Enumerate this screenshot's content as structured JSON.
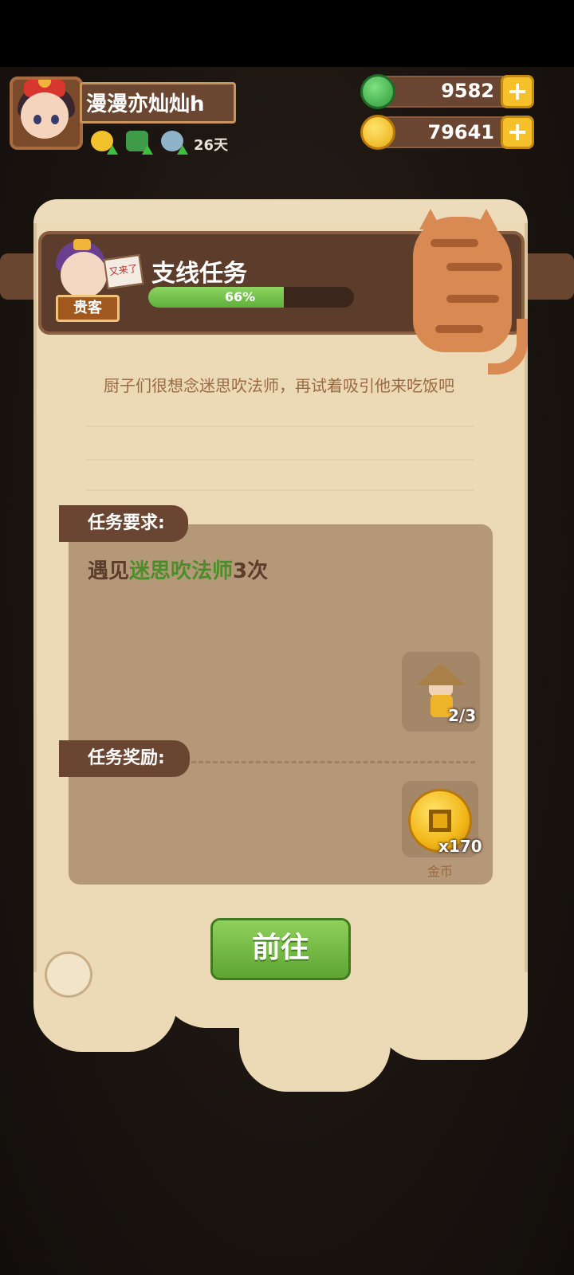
{
  "player": {
    "name": "漫漫亦灿灿h",
    "days": "26天"
  },
  "currencies": {
    "jade": "9582",
    "coins": "79641"
  },
  "quest": {
    "guest_badge": "贵客",
    "sign_text": "又来了",
    "title": "支线任务",
    "progress_fraction": 0.66,
    "progress_text": "66%",
    "description": "厨子们很想念迷思吹法师，再试着吸引他来吃饭吧",
    "requirement_tag": "任务要求:",
    "requirement_prefix": "遇见",
    "requirement_target": "迷思吹法师",
    "requirement_suffix": "3次",
    "requirement_count": "2/3",
    "reward_tag": "任务奖励:",
    "reward_amount": "x170",
    "reward_label": "金币",
    "go_button": "前往"
  },
  "icons": [
    "jade-icon",
    "coin-icon",
    "plus-icon",
    "buff-coin-icon",
    "buff-tree-icon",
    "buff-bowl-icon",
    "cat-mascot",
    "monk-icon"
  ],
  "colors": {
    "progress": "#6ab83f",
    "highlight": "#4a8e29",
    "button": "#6fb43e",
    "plus": "#f5c02a"
  }
}
